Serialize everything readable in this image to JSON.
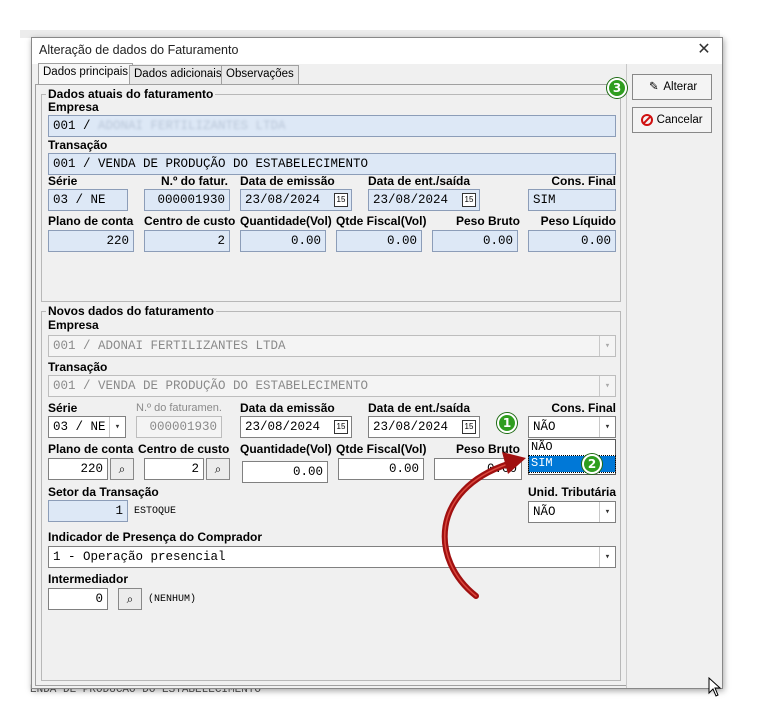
{
  "background": {
    "bottom_text": "ENDA DE PRODUCAO DO ESTABELECIMENTO"
  },
  "window": {
    "title": "Alteração de dados do Faturamento",
    "close": "✕"
  },
  "tabs": [
    "Dados principais",
    "Dados adicionais",
    "Observações"
  ],
  "buttons": {
    "alterar": "Alterar",
    "cancelar": "Cancelar"
  },
  "current": {
    "title": "Dados atuais do faturamento",
    "empresa_label": "Empresa",
    "empresa_code": "001 /",
    "empresa_name": "ADONAI FERTILIZANTES LTDA",
    "transacao_label": "Transação",
    "transacao_value": "001 / VENDA DE PRODUÇÃO DO ESTABELECIMENTO",
    "serie_label": "Série",
    "serie_value": "03 / NE",
    "nfatur_label": "N.º do fatur.",
    "nfatur_value": "000001930",
    "emissao_label": "Data de emissão",
    "emissao_value": "23/08/2024",
    "entsaida_label": "Data de ent./saída",
    "entsaida_value": "23/08/2024",
    "consfinal_label": "Cons. Final",
    "consfinal_value": "SIM",
    "plano_label": "Plano de conta",
    "plano_value": "220",
    "centro_label": "Centro de custo",
    "centro_value": "2",
    "qtdvol_label": "Quantidade(Vol)",
    "qtdvol_value": "0.00",
    "qtdfiscal_label": "Qtde Fiscal(Vol)",
    "qtdfiscal_value": "0.00",
    "pesobruto_label": "Peso Bruto",
    "pesobruto_value": "0.00",
    "pesoliq_label": "Peso Líquido",
    "pesoliq_value": "0.00"
  },
  "new": {
    "title": "Novos dados do faturamento",
    "empresa_label": "Empresa",
    "empresa_value": "001 / ADONAI FERTILIZANTES LTDA",
    "transacao_label": "Transação",
    "transacao_value": "001 / VENDA DE PRODUÇÃO DO ESTABELECIMENTO",
    "serie_label": "Série",
    "serie_value": "03 / NE",
    "nfatur_label": "N.º do faturamen.",
    "nfatur_value": "000001930",
    "emissao_label": "Data da emissão",
    "emissao_value": "23/08/2024",
    "entsaida_label": "Data de ent./saída",
    "entsaida_value": "23/08/2024",
    "consfinal_label": "Cons. Final",
    "consfinal_value": "NÃO",
    "consfinal_options": [
      "NÃO",
      "SIM"
    ],
    "consfinal_highlighted": "SIM",
    "plano_label": "Plano de conta",
    "plano_value": "220",
    "centro_label": "Centro de custo",
    "centro_value": "2",
    "qtdvol_label": "Quantidade(Vol)",
    "qtdvol_value": "0.00",
    "qtdfiscal_label": "Qtde Fiscal(Vol)",
    "qtdfiscal_value": "0.00",
    "pesobruto_label": "Peso Bruto",
    "pesobruto_value": "0.00",
    "setor_label": "Setor da Transação",
    "setor_value": "1",
    "setor_name": "ESTOQUE",
    "unid_label": "Unid. Tributária",
    "unid_value": "NÃO",
    "indicador_label": "Indicador de Presença do Comprador",
    "indicador_value": "1 - Operação presencial",
    "intermediador_label": "Intermediador",
    "intermediador_value": "0",
    "intermediador_name": "(NENHUM)"
  },
  "annotations": {
    "step1": "1",
    "step2": "2",
    "step3": "3",
    "arrow_color": "#a01010",
    "badge_color": "#2f9e1f"
  },
  "icons": {
    "calendar": "15",
    "lookup": "binoculars-icon",
    "dropdown": "▾"
  }
}
